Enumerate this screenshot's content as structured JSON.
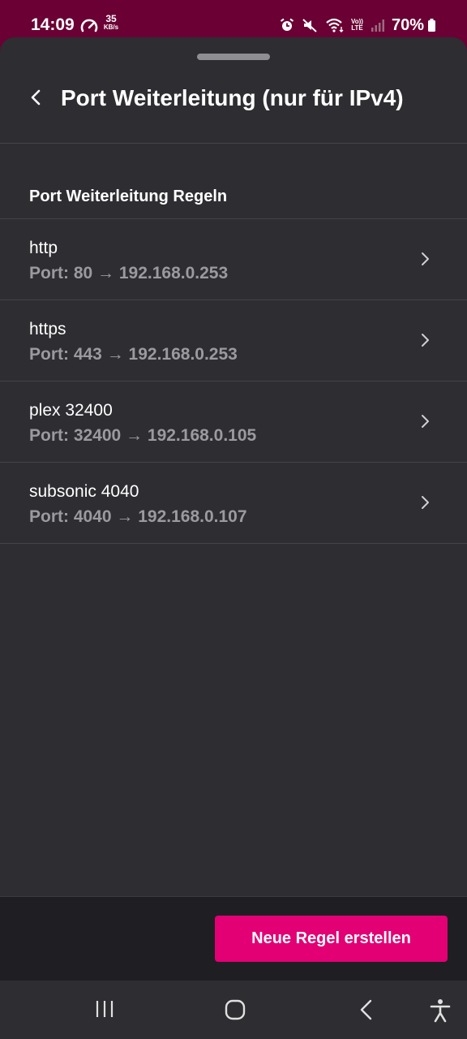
{
  "status_bar": {
    "time": "14:09",
    "net_speed_value": "35",
    "net_speed_unit": "KB/s",
    "volte_top": "Vo))",
    "volte_bottom": "LTE",
    "battery": "70%"
  },
  "header": {
    "title": "Port Weiterleitung (nur für IPv4)"
  },
  "section": {
    "title": "Port Weiterleitung Regeln"
  },
  "rules": [
    {
      "name": "http",
      "detail": "Port: 80 → 192.168.0.253"
    },
    {
      "name": "https",
      "detail": "Port: 443 → 192.168.0.253"
    },
    {
      "name": "plex 32400",
      "detail": "Port: 32400 → 192.168.0.105"
    },
    {
      "name": "subsonic 4040",
      "detail": "Port: 4040 → 192.168.0.107"
    }
  ],
  "actions": {
    "create_rule_label": "Neue Regel erstellen"
  },
  "colors": {
    "accent": "#e20074",
    "status_bar": "#6a0034",
    "surface": "#2d2d32",
    "bottom_bar": "#1f1f23"
  },
  "icons": {
    "back": "back-arrow-icon",
    "chevron": "chevron-right-icon",
    "nav": [
      "recent-apps-icon",
      "home-icon",
      "nav-back-icon",
      "accessibility-icon"
    ]
  }
}
